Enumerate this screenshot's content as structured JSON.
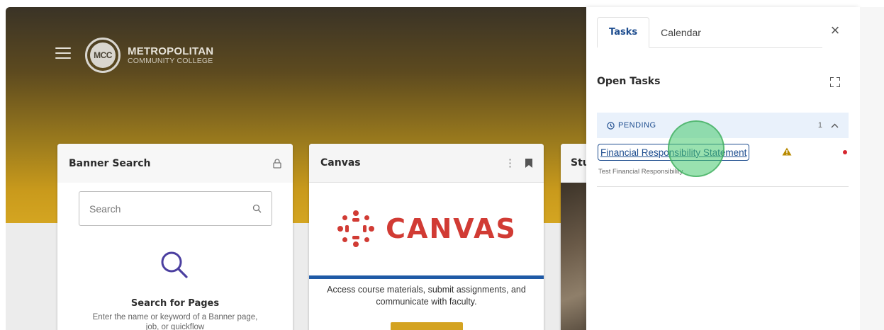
{
  "header": {
    "logo_initials": "MCC",
    "logo_name": "METROPOLITAN",
    "logo_subtitle": "COMMUNITY COLLEGE"
  },
  "cards": {
    "banner": {
      "title": "Banner Search",
      "search_placeholder": "Search",
      "heading": "Search for Pages",
      "description": "Enter the name or keyword of a Banner page, job, or quickflow"
    },
    "canvas": {
      "title": "Canvas",
      "logo_text": "CANVAS",
      "description": "Access course materials, submit assignments, and communicate with faculty."
    },
    "student": {
      "title_fragment": "Stu"
    }
  },
  "panel": {
    "tabs": [
      {
        "label": "Tasks",
        "active": true
      },
      {
        "label": "Calendar",
        "active": false
      }
    ],
    "close_glyph": "×",
    "section_title": "Open Tasks",
    "group": {
      "label": "PENDING",
      "count": "1"
    },
    "task": {
      "title": "Financial Responsibility Statement",
      "subtitle": "Test Financial Responsibility"
    }
  },
  "colors": {
    "accent_blue": "#1e4d8f",
    "canvas_red": "#d13b34",
    "gold": "#d4a321",
    "warning": "#b88a00",
    "alert_red": "#d6262f"
  },
  "icons": [
    "hamburger-menu-icon",
    "lock-icon",
    "search-icon",
    "kebab-menu-icon",
    "bookmark-icon",
    "close-icon",
    "expand-icon",
    "clock-icon",
    "chevron-up-icon",
    "warning-icon"
  ]
}
